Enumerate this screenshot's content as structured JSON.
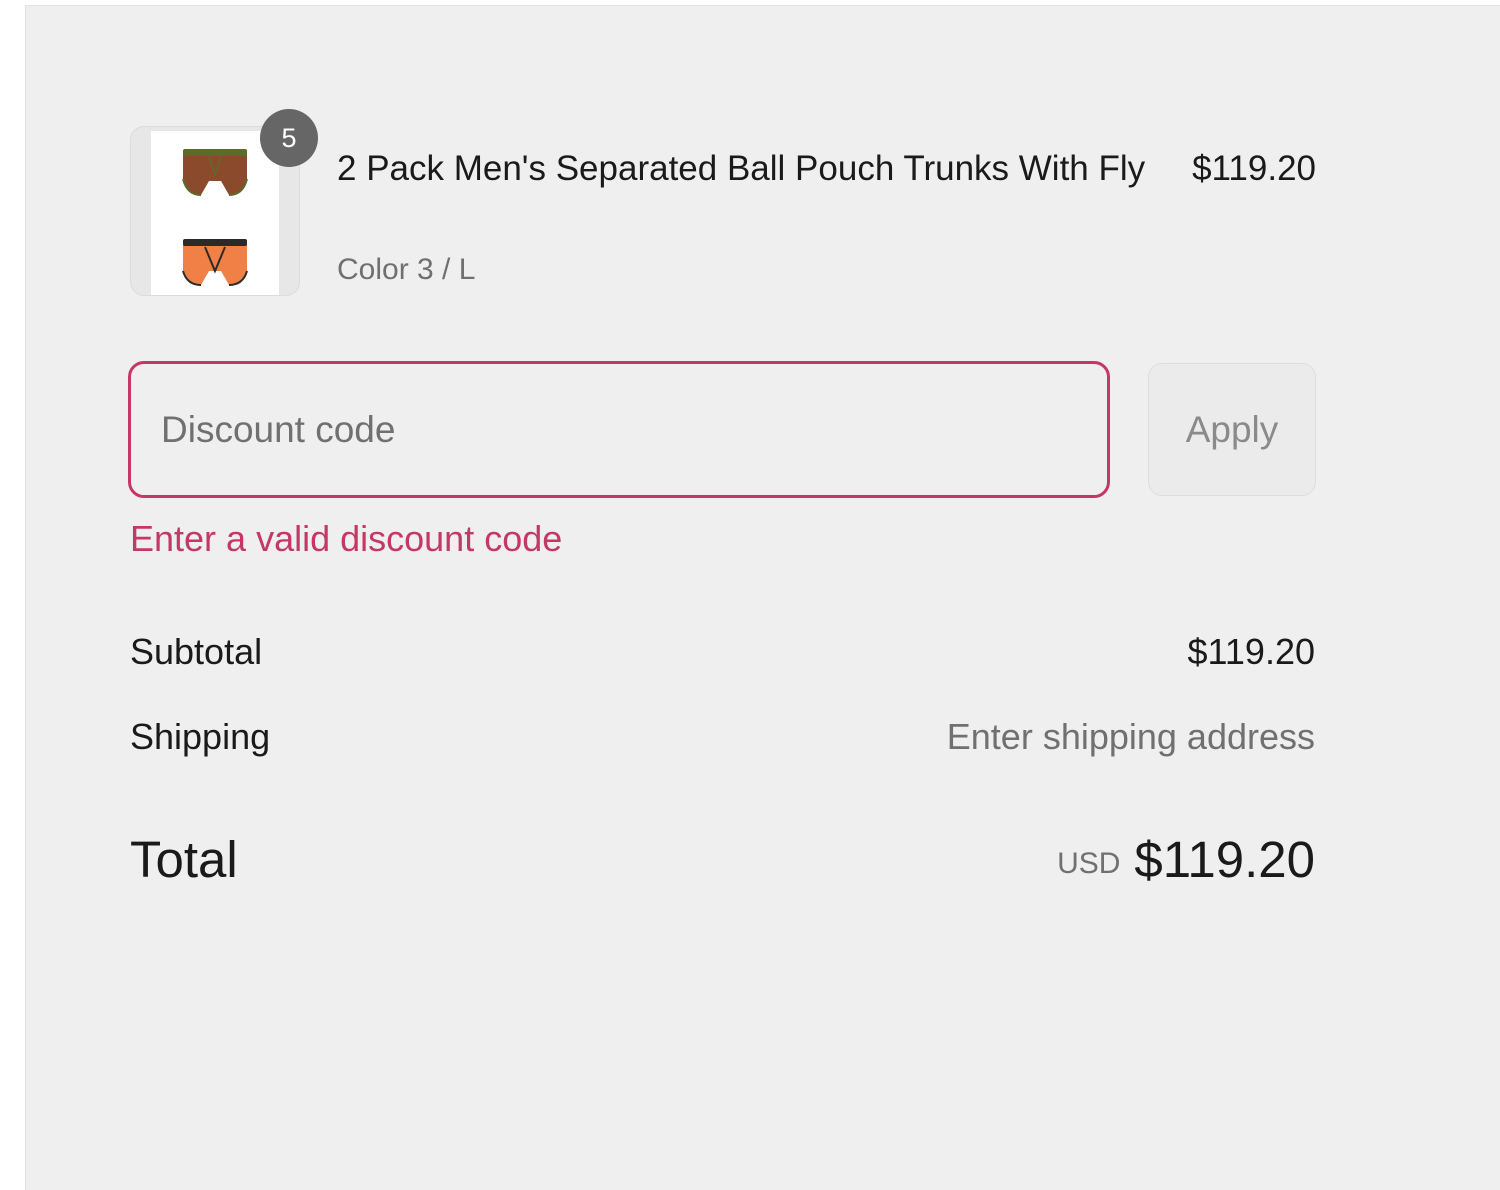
{
  "product": {
    "quantity": "5",
    "title": "2 Pack Men's Separated Ball Pouch Trunks With Fly",
    "variant": "Color 3 / L",
    "price": "$119.20",
    "image_icon": "underwear-trunks-thumbnail"
  },
  "discount": {
    "placeholder": "Discount code",
    "value": "",
    "apply_label": "Apply",
    "error": "Enter a valid discount code"
  },
  "totals": {
    "subtotal_label": "Subtotal",
    "subtotal_value": "$119.20",
    "shipping_label": "Shipping",
    "shipping_value": "Enter shipping address",
    "total_label": "Total",
    "currency": "USD",
    "total_value": "$119.20"
  },
  "colors": {
    "error": "#c53765",
    "panel_background": "#efefef",
    "badge": "#666666"
  }
}
